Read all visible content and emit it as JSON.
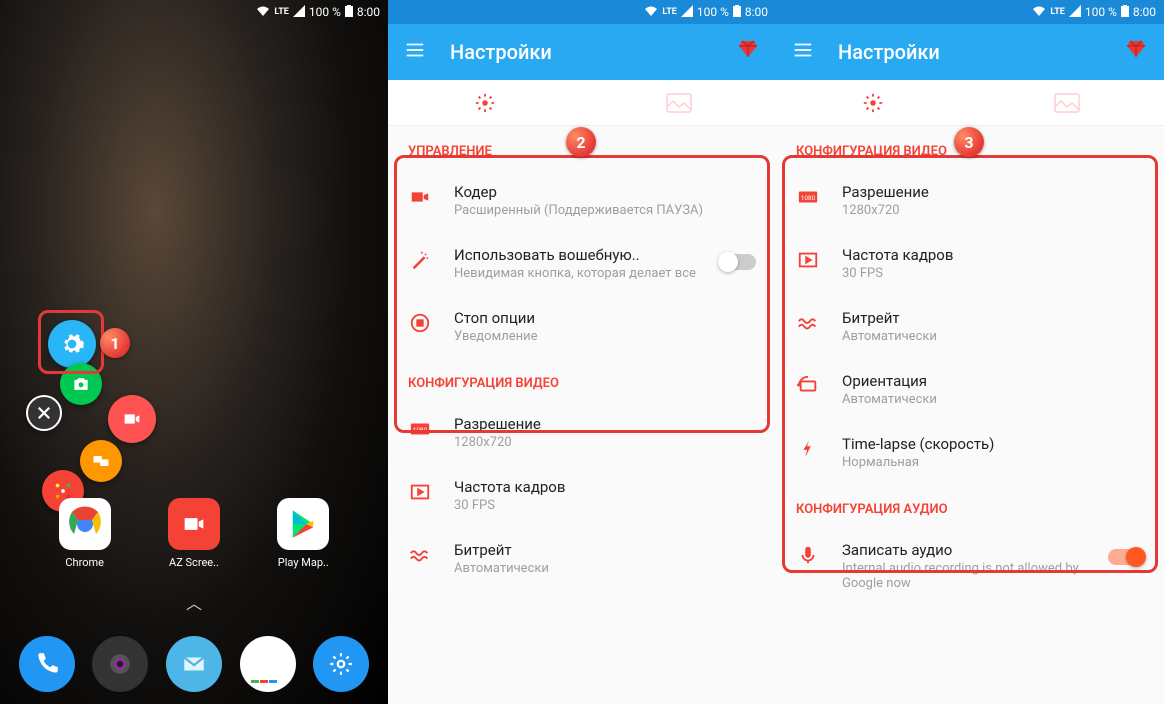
{
  "status": {
    "net": "LTE",
    "battery": "100 %",
    "time": "8:00"
  },
  "phone1": {
    "apps": {
      "chrome": "Chrome",
      "az": "AZ Scree..",
      "play": "Play Мар.."
    }
  },
  "appbar": {
    "title": "Настройки"
  },
  "callouts": {
    "one": "1",
    "two": "2",
    "three": "3"
  },
  "sections": {
    "control": "УПРАВЛЕНИЕ",
    "video": "КОНФИГУРАЦИЯ ВИДЕО",
    "audio": "КОНФИГУРАЦИЯ АУДИО"
  },
  "settings": {
    "coder": {
      "label": "Кодер",
      "sub": "Расширенный (Поддерживается ПАУЗА)"
    },
    "magic": {
      "label": "Использовать вошебную..",
      "sub": "Невидимая кнопка, которая делает все"
    },
    "stop": {
      "label": "Стоп опции",
      "sub": "Уведомление"
    },
    "resolution": {
      "label": "Разрешение",
      "sub": "1280x720"
    },
    "fps": {
      "label": "Частота кадров",
      "sub": "30 FPS"
    },
    "bitrate": {
      "label": "Битрейт",
      "sub": "Автоматически"
    },
    "orientation": {
      "label": "Ориентация",
      "sub": "Автоматически"
    },
    "timelapse": {
      "label": "Time-lapse (скорость)",
      "sub": "Нормальная"
    },
    "audio": {
      "label": "Записать аудио",
      "sub": "Internal audio recording is not allowed by Google now"
    }
  }
}
